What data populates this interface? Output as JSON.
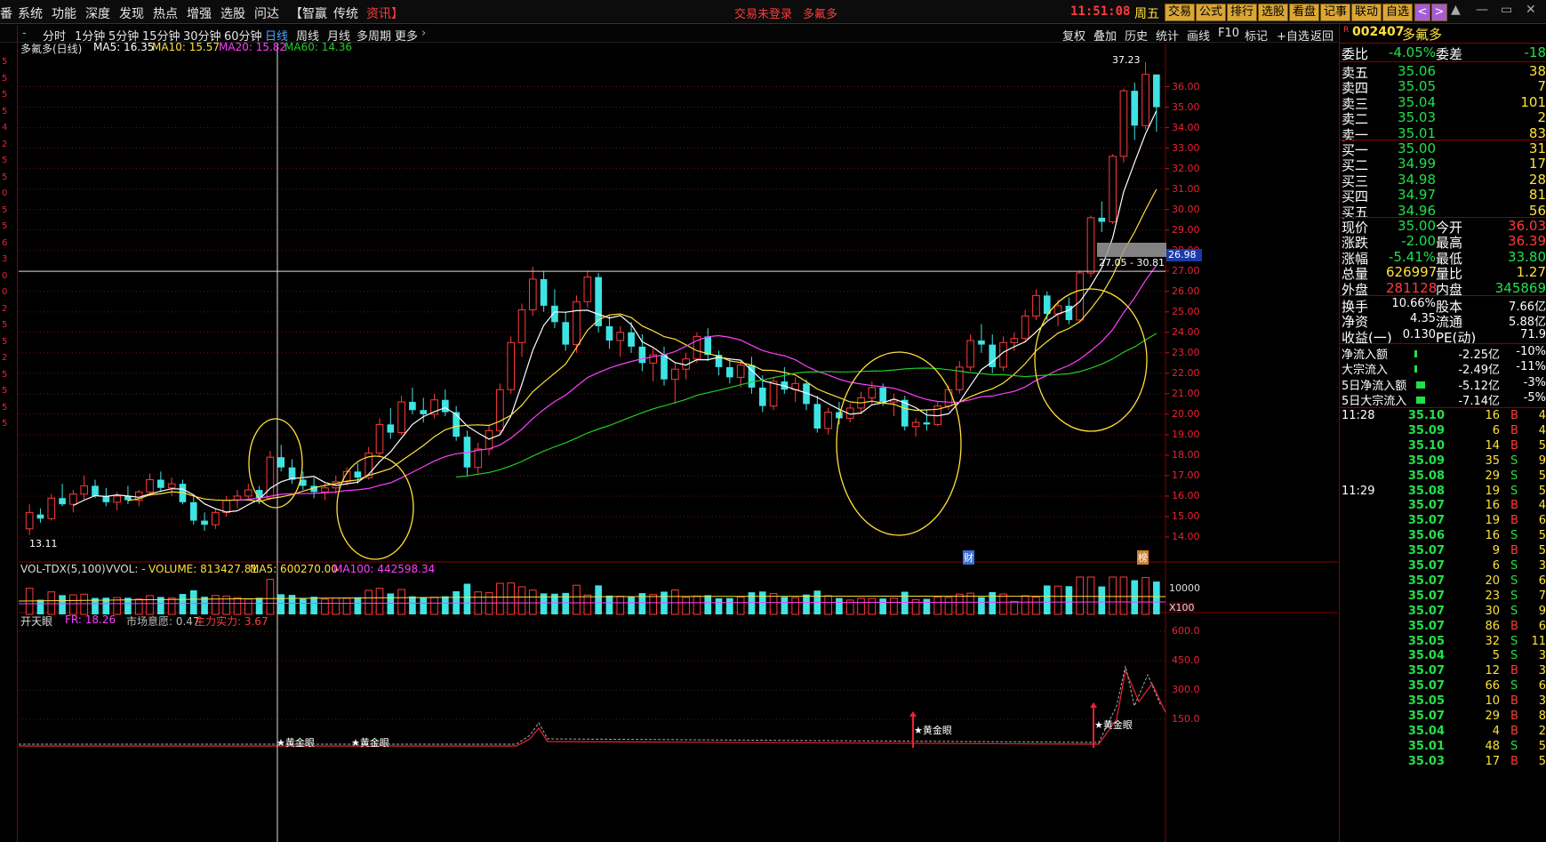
{
  "app": {
    "menu": [
      "系统",
      "功能",
      "深度",
      "发现",
      "热点",
      "增强",
      "选股",
      "问达"
    ],
    "menu_left_tag": "番",
    "brand_tabs": [
      "【智赢",
      "传统",
      "资讯】"
    ],
    "login_status": "交易未登录",
    "center_title": "多氟多",
    "clock": "11:51:08",
    "weekday": "周五",
    "top_buttons": [
      "交易",
      "公式",
      "排行",
      "选股",
      "看盘",
      "记事",
      "联动",
      "自选"
    ],
    "nav_arrows": [
      "<",
      ">"
    ],
    "window_buttons": [
      "▲",
      "—",
      "▭",
      "✕"
    ],
    "accent_colors": {
      "up": "#ff3b3b",
      "down": "#22e04a",
      "ma5": "#ffffff",
      "ma10": "#ffe13b",
      "ma20": "#ff40ff",
      "ma60": "#22cc22",
      "volume_down": "#3ee3e3"
    }
  },
  "periods": [
    "分时",
    "1分钟",
    "5分钟",
    "15分钟",
    "30分钟",
    "60分钟",
    "日线",
    "周线",
    "月线",
    "多周期",
    "更多"
  ],
  "active_period": "日线",
  "chart_tools": [
    "复权",
    "叠加",
    "历史",
    "统计",
    "画线",
    "F10",
    "标记",
    "+自选",
    "返回"
  ],
  "main_indicator": {
    "stock_label": "多氟多(日线)",
    "ma5": "MA5: 16.35",
    "ma10": "MA10: 15.57",
    "ma20": "MA20: 15.82",
    "ma60": "MA60: 14.36"
  },
  "price_axis_labels": [
    "36.00",
    "35.00",
    "34.00",
    "33.00",
    "32.00",
    "31.00",
    "30.00",
    "29.00",
    "28.00",
    "27.00",
    "26.00",
    "25.00",
    "24.00",
    "23.00",
    "22.00",
    "21.00",
    "20.00",
    "19.00",
    "18.00",
    "17.00",
    "16.00",
    "15.00",
    "14.00"
  ],
  "crosshair_value": "26.98",
  "annotations": {
    "high": "37.23",
    "low": "13.11",
    "range": "27.05 - 30.81",
    "cai": "财",
    "bang": "榜"
  },
  "volume_indicator": {
    "name": "VOL-TDX(5,100)",
    "vvol": "VVOL: -",
    "volume": "VOLUME: 813427.81",
    "ma5": "MA5: 600270.00",
    "ma100": "MA100: 442598.34",
    "axis": "10000",
    "unit": "X100"
  },
  "lower_indicator": {
    "name": "开天眼",
    "fr": "FR: 18.26",
    "sentiment": "市场意愿: 0.47",
    "power": "主力实力: 3.67",
    "axis": [
      "600.0",
      "450.0",
      "300.0",
      "150.0"
    ],
    "signal": "★黄金眼"
  },
  "left_strip_labels": [
    "5",
    "5",
    "5",
    "5",
    "4",
    "2",
    "5",
    "5",
    "0",
    "5",
    "5",
    "6",
    "3",
    "0",
    "0",
    "2",
    "5",
    "5",
    "2",
    "5",
    "5",
    "5",
    "5"
  ],
  "quote": {
    "code": "002407",
    "code_prefix": "R",
    "name": "多氟多",
    "weibi_label": "委比",
    "weibi": "-4.05%",
    "weicha_label": "委差",
    "weicha": "-18",
    "asks": [
      {
        "label": "卖五",
        "price": "35.06",
        "vol": "38"
      },
      {
        "label": "卖四",
        "price": "35.05",
        "vol": "7"
      },
      {
        "label": "卖三",
        "price": "35.04",
        "vol": "101"
      },
      {
        "label": "卖二",
        "price": "35.03",
        "vol": "2"
      },
      {
        "label": "卖一",
        "price": "35.01",
        "vol": "83"
      }
    ],
    "bids": [
      {
        "label": "买一",
        "price": "35.00",
        "vol": "31"
      },
      {
        "label": "买二",
        "price": "34.99",
        "vol": "17"
      },
      {
        "label": "买三",
        "price": "34.98",
        "vol": "28"
      },
      {
        "label": "买四",
        "price": "34.97",
        "vol": "81"
      },
      {
        "label": "买五",
        "price": "34.96",
        "vol": "56"
      }
    ],
    "stats": [
      {
        "l1": "现价",
        "v1": "35.00",
        "l2": "今开",
        "v2": "36.03"
      },
      {
        "l1": "涨跌",
        "v1": "-2.00",
        "l2": "最高",
        "v2": "36.39"
      },
      {
        "l1": "涨幅",
        "v1": "-5.41%",
        "l2": "最低",
        "v2": "33.80"
      },
      {
        "l1": "总量",
        "v1": "626997",
        "l2": "量比",
        "v2": "1.27"
      },
      {
        "l1": "外盘",
        "v1": "281128",
        "l2": "内盘",
        "v2": "345869"
      }
    ],
    "fundamentals": [
      {
        "l1": "换手",
        "v1": "10.66%",
        "l2": "股本",
        "v2": "7.66亿"
      },
      {
        "l1": "净资",
        "v1": "4.35",
        "l2": "流通",
        "v2": "5.88亿"
      },
      {
        "l1": "收益(一)",
        "v1": "0.130",
        "l2": "PE(动)",
        "v2": "71.9"
      }
    ],
    "flows": [
      {
        "label": "净流入额",
        "value": "-2.25亿",
        "pct": "-10%"
      },
      {
        "label": "大宗流入",
        "value": "-2.49亿",
        "pct": "-11%"
      },
      {
        "label": "5日净流入额",
        "value": "-5.12亿",
        "pct": "-3%"
      },
      {
        "label": "5日大宗流入",
        "value": "-7.14亿",
        "pct": "-5%"
      }
    ],
    "ticks": [
      {
        "time": "11:28",
        "price": "35.10",
        "vol": "16",
        "side": "B",
        "n": "4"
      },
      {
        "time": "",
        "price": "35.09",
        "vol": "6",
        "side": "B",
        "n": "4"
      },
      {
        "time": "",
        "price": "35.10",
        "vol": "14",
        "side": "B",
        "n": "5"
      },
      {
        "time": "",
        "price": "35.09",
        "vol": "35",
        "side": "S",
        "n": "9"
      },
      {
        "time": "",
        "price": "35.08",
        "vol": "29",
        "side": "S",
        "n": "5"
      },
      {
        "time": "11:29",
        "price": "35.08",
        "vol": "19",
        "side": "S",
        "n": "5"
      },
      {
        "time": "",
        "price": "35.07",
        "vol": "16",
        "side": "B",
        "n": "4"
      },
      {
        "time": "",
        "price": "35.07",
        "vol": "19",
        "side": "B",
        "n": "6"
      },
      {
        "time": "",
        "price": "35.06",
        "vol": "16",
        "side": "S",
        "n": "5"
      },
      {
        "time": "",
        "price": "35.07",
        "vol": "9",
        "side": "B",
        "n": "5"
      },
      {
        "time": "",
        "price": "35.07",
        "vol": "6",
        "side": "S",
        "n": "3"
      },
      {
        "time": "",
        "price": "35.07",
        "vol": "20",
        "side": "S",
        "n": "6"
      },
      {
        "time": "",
        "price": "35.07",
        "vol": "23",
        "side": "S",
        "n": "7"
      },
      {
        "time": "",
        "price": "35.07",
        "vol": "30",
        "side": "S",
        "n": "9"
      },
      {
        "time": "",
        "price": "35.07",
        "vol": "86",
        "side": "B",
        "n": "6"
      },
      {
        "time": "",
        "price": "35.05",
        "vol": "32",
        "side": "S",
        "n": "11"
      },
      {
        "time": "",
        "price": "35.04",
        "vol": "5",
        "side": "S",
        "n": "3"
      },
      {
        "time": "",
        "price": "35.07",
        "vol": "12",
        "side": "B",
        "n": "3"
      },
      {
        "time": "",
        "price": "35.07",
        "vol": "66",
        "side": "S",
        "n": "6"
      },
      {
        "time": "",
        "price": "35.05",
        "vol": "10",
        "side": "B",
        "n": "3"
      },
      {
        "time": "",
        "price": "35.07",
        "vol": "29",
        "side": "B",
        "n": "8"
      },
      {
        "time": "",
        "price": "35.04",
        "vol": "4",
        "side": "B",
        "n": "2"
      },
      {
        "time": "",
        "price": "35.01",
        "vol": "48",
        "side": "S",
        "n": "5"
      },
      {
        "time": "",
        "price": "35.03",
        "vol": "17",
        "side": "B",
        "n": "5"
      }
    ]
  },
  "chart_data": {
    "type": "candlestick",
    "y_range": [
      13.0,
      37.5
    ],
    "candles": [
      [
        14.4,
        15.6,
        14.1,
        15.2
      ],
      [
        15.1,
        15.4,
        14.7,
        14.9
      ],
      [
        14.9,
        16.1,
        14.8,
        15.9
      ],
      [
        15.9,
        16.6,
        15.5,
        15.6
      ],
      [
        15.6,
        16.3,
        15.2,
        16.1
      ],
      [
        16.1,
        17.0,
        15.8,
        16.5
      ],
      [
        16.5,
        16.8,
        15.9,
        16.0
      ],
      [
        16.0,
        16.4,
        15.5,
        15.7
      ],
      [
        15.7,
        16.2,
        15.3,
        16.0
      ],
      [
        16.0,
        16.5,
        15.6,
        15.8
      ],
      [
        15.8,
        16.3,
        15.5,
        16.2
      ],
      [
        16.2,
        17.1,
        16.0,
        16.8
      ],
      [
        16.8,
        17.2,
        16.2,
        16.4
      ],
      [
        16.4,
        16.9,
        16.0,
        16.6
      ],
      [
        16.6,
        16.8,
        15.6,
        15.7
      ],
      [
        15.7,
        16.0,
        14.6,
        14.8
      ],
      [
        14.8,
        15.2,
        14.3,
        14.6
      ],
      [
        14.6,
        15.4,
        14.4,
        15.2
      ],
      [
        15.2,
        16.0,
        15.0,
        15.8
      ],
      [
        15.8,
        16.3,
        15.4,
        16.0
      ],
      [
        16.0,
        16.6,
        15.8,
        16.3
      ],
      [
        16.3,
        16.5,
        15.6,
        15.9
      ],
      [
        15.9,
        18.2,
        15.8,
        17.9
      ],
      [
        17.9,
        18.5,
        17.2,
        17.4
      ],
      [
        17.4,
        17.8,
        16.6,
        16.8
      ],
      [
        16.8,
        17.2,
        16.3,
        16.5
      ],
      [
        16.5,
        16.9,
        15.9,
        16.2
      ],
      [
        16.2,
        16.6,
        15.8,
        16.4
      ],
      [
        16.4,
        17.0,
        16.1,
        16.7
      ],
      [
        16.7,
        17.4,
        16.5,
        17.2
      ],
      [
        17.2,
        17.6,
        16.6,
        16.9
      ],
      [
        16.9,
        18.4,
        16.8,
        18.1
      ],
      [
        18.1,
        19.8,
        17.9,
        19.5
      ],
      [
        19.5,
        20.3,
        18.8,
        19.1
      ],
      [
        19.1,
        20.9,
        19.0,
        20.6
      ],
      [
        20.6,
        21.3,
        20.0,
        20.2
      ],
      [
        20.2,
        20.8,
        19.6,
        20.0
      ],
      [
        20.0,
        21.0,
        19.8,
        20.7
      ],
      [
        20.7,
        21.2,
        19.9,
        20.1
      ],
      [
        20.1,
        20.4,
        18.7,
        18.9
      ],
      [
        18.9,
        19.2,
        17.0,
        17.4
      ],
      [
        17.4,
        18.6,
        17.1,
        18.3
      ],
      [
        18.3,
        19.5,
        18.0,
        19.2
      ],
      [
        19.2,
        21.5,
        19.0,
        21.2
      ],
      [
        21.2,
        23.8,
        21.0,
        23.5
      ],
      [
        23.5,
        25.4,
        22.8,
        25.1
      ],
      [
        25.1,
        27.2,
        24.8,
        26.6
      ],
      [
        26.6,
        27.0,
        25.0,
        25.3
      ],
      [
        25.3,
        26.1,
        24.2,
        24.5
      ],
      [
        24.5,
        25.0,
        23.1,
        23.4
      ],
      [
        23.4,
        25.8,
        23.0,
        25.5
      ],
      [
        25.5,
        27.0,
        25.2,
        26.7
      ],
      [
        26.7,
        26.9,
        24.0,
        24.3
      ],
      [
        24.3,
        24.8,
        23.2,
        23.6
      ],
      [
        23.6,
        24.3,
        22.8,
        24.0
      ],
      [
        24.0,
        24.5,
        23.0,
        23.3
      ],
      [
        23.3,
        23.9,
        22.1,
        22.5
      ],
      [
        22.5,
        23.2,
        21.6,
        22.9
      ],
      [
        22.9,
        23.3,
        21.4,
        21.7
      ],
      [
        21.7,
        22.5,
        20.5,
        22.2
      ],
      [
        22.2,
        23.0,
        21.7,
        22.7
      ],
      [
        22.7,
        24.0,
        22.5,
        23.8
      ],
      [
        23.8,
        24.2,
        22.6,
        22.9
      ],
      [
        22.9,
        23.1,
        21.9,
        22.3
      ],
      [
        22.3,
        22.7,
        21.5,
        21.8
      ],
      [
        21.8,
        22.6,
        21.3,
        22.4
      ],
      [
        22.4,
        22.8,
        21.0,
        21.3
      ],
      [
        21.3,
        21.9,
        20.1,
        20.4
      ],
      [
        20.4,
        21.8,
        20.2,
        21.6
      ],
      [
        21.6,
        22.3,
        21.0,
        21.2
      ],
      [
        21.2,
        21.8,
        20.6,
        21.5
      ],
      [
        21.5,
        21.7,
        20.2,
        20.5
      ],
      [
        20.5,
        20.9,
        19.1,
        19.3
      ],
      [
        19.3,
        20.3,
        19.0,
        20.1
      ],
      [
        20.1,
        20.6,
        19.5,
        19.8
      ],
      [
        19.8,
        20.5,
        19.6,
        20.3
      ],
      [
        20.3,
        21.1,
        20.0,
        20.8
      ],
      [
        20.8,
        21.6,
        20.5,
        21.3
      ],
      [
        21.3,
        21.5,
        20.4,
        20.6
      ],
      [
        20.6,
        21.0,
        19.9,
        20.7
      ],
      [
        20.7,
        20.9,
        19.2,
        19.4
      ],
      [
        19.4,
        19.8,
        18.9,
        19.6
      ],
      [
        19.6,
        20.2,
        19.2,
        19.5
      ],
      [
        19.5,
        20.6,
        19.4,
        20.4
      ],
      [
        20.4,
        21.4,
        20.2,
        21.2
      ],
      [
        21.2,
        22.6,
        21.0,
        22.3
      ],
      [
        22.3,
        23.9,
        22.1,
        23.6
      ],
      [
        23.6,
        24.4,
        23.0,
        23.4
      ],
      [
        23.4,
        23.9,
        22.0,
        22.3
      ],
      [
        22.3,
        23.8,
        22.1,
        23.5
      ],
      [
        23.5,
        24.0,
        23.1,
        23.7
      ],
      [
        23.7,
        25.1,
        23.5,
        24.8
      ],
      [
        24.8,
        26.1,
        24.6,
        25.8
      ],
      [
        25.8,
        26.0,
        24.6,
        24.9
      ],
      [
        24.9,
        25.6,
        24.3,
        25.3
      ],
      [
        25.3,
        25.7,
        24.4,
        24.6
      ],
      [
        24.6,
        27.0,
        24.5,
        26.9
      ],
      [
        26.9,
        29.7,
        26.7,
        29.6
      ],
      [
        29.6,
        30.4,
        28.9,
        29.4
      ],
      [
        29.4,
        32.7,
        29.3,
        32.6
      ],
      [
        32.6,
        35.9,
        32.3,
        35.8
      ],
      [
        35.8,
        36.2,
        33.4,
        34.1
      ],
      [
        34.1,
        37.2,
        33.9,
        36.6
      ],
      [
        36.6,
        36.4,
        33.8,
        35.0
      ]
    ]
  }
}
